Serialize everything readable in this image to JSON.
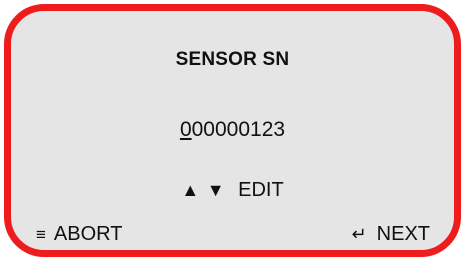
{
  "screen": {
    "title": "SENSOR SN",
    "serial": {
      "cursor_digit": "0",
      "remaining_digits": "00000123"
    },
    "edit_hint": {
      "up_arrow": "▲",
      "down_arrow": "▼",
      "label": "EDIT"
    },
    "softkeys": {
      "left": {
        "icon": "≡",
        "icon_name": "menu-icon",
        "label": "ABORT"
      },
      "right": {
        "icon": "↵",
        "icon_name": "return-icon",
        "label": "NEXT"
      }
    }
  },
  "colors": {
    "frame": "#ee1c1c",
    "background": "#e5e5e5",
    "text": "#111111"
  }
}
